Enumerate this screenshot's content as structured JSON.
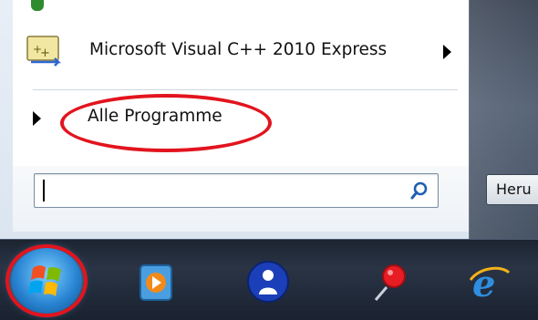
{
  "start_menu": {
    "pinned_program": {
      "label": "Microsoft Visual C++ 2010 Express",
      "icon": "visual-cpp-icon",
      "has_submenu": true
    },
    "all_programs": {
      "label": "Alle Programme",
      "highlight_color": "#e2141e"
    },
    "search": {
      "value": "",
      "placeholder": "",
      "icon": "magnifier-icon"
    }
  },
  "right_panel": {
    "button_label": "Heru"
  },
  "taskbar": {
    "start_orb_highlighted": true,
    "icons": [
      "windows-start-orb",
      "media-player-icon",
      "user-icon",
      "pushpin-icon",
      "internet-explorer-icon"
    ]
  },
  "colors": {
    "highlight_red": "#e2141e",
    "taskbar": "#1e2634",
    "menu_background": "#ffffff"
  }
}
